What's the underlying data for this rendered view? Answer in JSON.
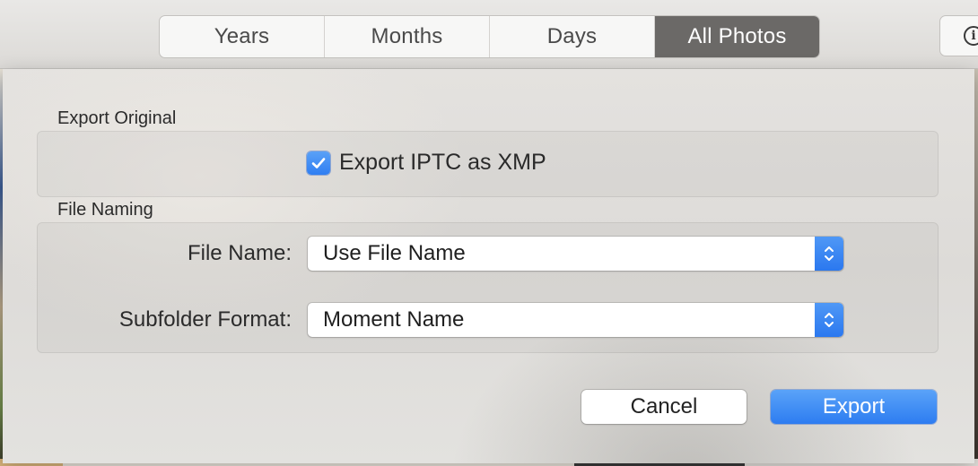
{
  "toolbar": {
    "tabs": [
      {
        "label": "Years",
        "active": false
      },
      {
        "label": "Months",
        "active": false
      },
      {
        "label": "Days",
        "active": false
      },
      {
        "label": "All Photos",
        "active": true
      }
    ],
    "info_icon": "info-circle-icon"
  },
  "dialog": {
    "export_original": {
      "heading": "Export Original",
      "checkbox_label": "Export IPTC as XMP",
      "checkbox_checked": true
    },
    "file_naming": {
      "heading": "File Naming",
      "file_name_label": "File Name:",
      "file_name_value": "Use File Name",
      "subfolder_label": "Subfolder Format:",
      "subfolder_value": "Moment Name"
    },
    "buttons": {
      "cancel": "Cancel",
      "export": "Export"
    }
  },
  "colors": {
    "accent": "#2f7ef2",
    "active_tab": "#6b6967"
  }
}
